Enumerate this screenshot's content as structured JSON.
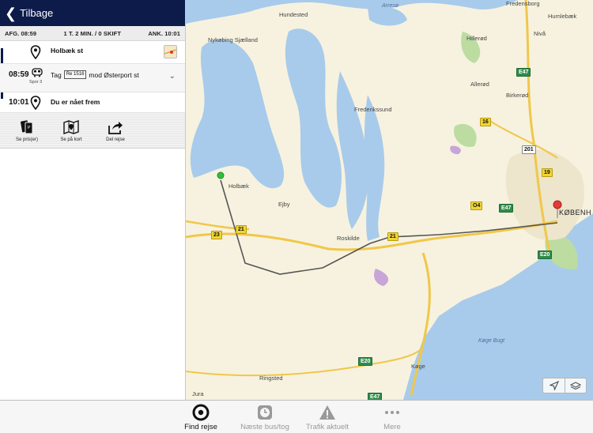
{
  "nav": {
    "back_label": "Tilbage"
  },
  "summary": {
    "departure": "AFG. 08:59",
    "middle": "1 T. 2 MIN. / 0 SKIFT",
    "arrival": "ANK. 10:01"
  },
  "trip": {
    "origin": "Holbæk st",
    "leg": {
      "time": "08:59",
      "platform": "Spor 3",
      "tag_word": "Tag",
      "train": "Re 1516",
      "direction": "mod Østerport st"
    },
    "arrival_time": "10:01",
    "arrival_text": "Du er nået frem"
  },
  "actions": [
    {
      "label": "Se pris(er)",
      "icon": "tickets-icon"
    },
    {
      "label": "Se på kort",
      "icon": "map-pin-icon"
    },
    {
      "label": "Del rejse",
      "icon": "share-icon"
    }
  ],
  "map": {
    "places": [
      "Arresø",
      "Hundested",
      "Frederikssund",
      "Hillerød",
      "Allerød",
      "Birkerød",
      "Nivå",
      "Humlebæk",
      "Fredensborg",
      "Nykøbing Sjælland",
      "Holbæk",
      "Ejby",
      "Roskilde",
      "Køge",
      "Køge Bugt",
      "Ringsted",
      "Jura",
      "KØBENH"
    ],
    "roads": [
      "E47",
      "16",
      "201",
      "19",
      "O4",
      "E47",
      "E20",
      "21",
      "21",
      "23",
      "E20",
      "E47"
    ]
  },
  "tabs": [
    {
      "label": "Find rejse",
      "icon": "target-icon",
      "active": true
    },
    {
      "label": "Næste bus/tog",
      "icon": "clock-icon",
      "active": false
    },
    {
      "label": "Trafik aktuelt",
      "icon": "warning-icon",
      "active": false
    },
    {
      "label": "Mere",
      "icon": "more-icon",
      "active": false
    }
  ],
  "colors": {
    "navbar": "#0c1b4a",
    "route_line": "#555555",
    "water": "#a8cbeb",
    "land": "#f7f2df"
  }
}
